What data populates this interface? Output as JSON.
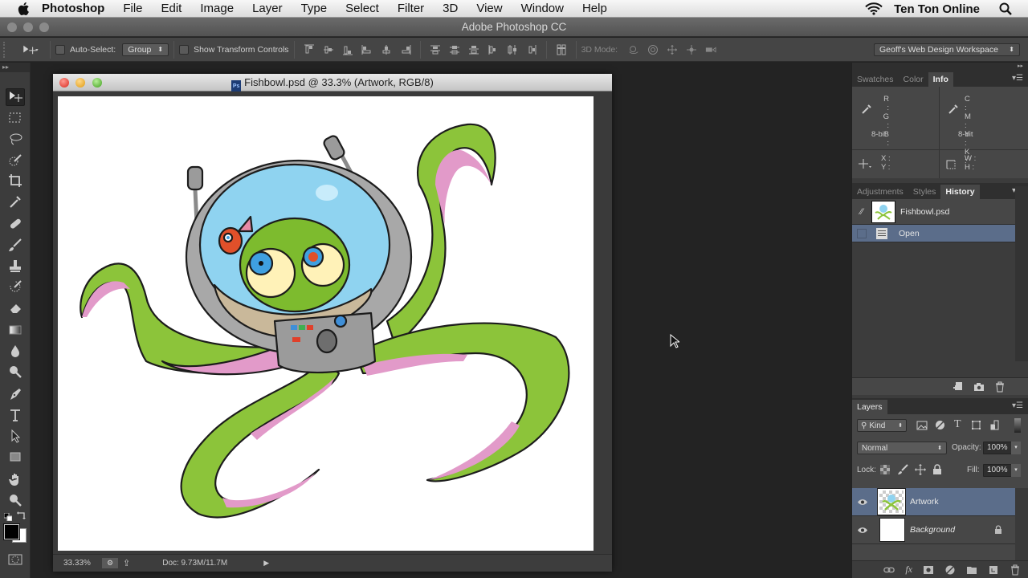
{
  "menubar": {
    "app_name": "Photoshop",
    "items": [
      "File",
      "Edit",
      "Image",
      "Layer",
      "Type",
      "Select",
      "Filter",
      "3D",
      "View",
      "Window",
      "Help"
    ],
    "user": "Ten Ton Online"
  },
  "titlebar": {
    "title": "Adobe Photoshop CC"
  },
  "options": {
    "auto_select_label": "Auto-Select:",
    "auto_select_checked": false,
    "auto_select_target": "Group",
    "show_transform_label": "Show Transform Controls",
    "show_transform_checked": false,
    "mode_3d_label": "3D Mode:",
    "workspace": "Geoff's Web Design Workspace"
  },
  "tools": [
    {
      "name": "move",
      "icon": "move-tool-icon"
    },
    {
      "name": "rectangular-marquee",
      "icon": "marquee-tool-icon"
    },
    {
      "name": "lasso",
      "icon": "lasso-tool-icon"
    },
    {
      "name": "quick-selection",
      "icon": "quick-selection-tool-icon"
    },
    {
      "name": "crop",
      "icon": "crop-tool-icon"
    },
    {
      "name": "eyedropper",
      "icon": "eyedropper-tool-icon"
    },
    {
      "name": "spot-healing",
      "icon": "healing-brush-tool-icon"
    },
    {
      "name": "brush",
      "icon": "brush-tool-icon"
    },
    {
      "name": "clone-stamp",
      "icon": "clone-stamp-tool-icon"
    },
    {
      "name": "history-brush",
      "icon": "history-brush-tool-icon"
    },
    {
      "name": "eraser",
      "icon": "eraser-tool-icon"
    },
    {
      "name": "gradient",
      "icon": "gradient-tool-icon"
    },
    {
      "name": "blur",
      "icon": "blur-tool-icon"
    },
    {
      "name": "dodge",
      "icon": "dodge-tool-icon"
    },
    {
      "name": "pen",
      "icon": "pen-tool-icon"
    },
    {
      "name": "type",
      "icon": "type-tool-icon"
    },
    {
      "name": "path-selection",
      "icon": "path-selection-tool-icon"
    },
    {
      "name": "rectangle",
      "icon": "rectangle-tool-icon"
    },
    {
      "name": "hand",
      "icon": "hand-tool-icon"
    },
    {
      "name": "zoom",
      "icon": "zoom-tool-icon"
    }
  ],
  "colors": {
    "foreground": "#000000",
    "background": "#ffffff",
    "selection": "#5b6d8a",
    "accent_panel": "#474747"
  },
  "document": {
    "title": "Fishbowl.psd @ 33.3% (Artwork, RGB/8)",
    "zoom": "33.33%",
    "doc_size": "Doc: 9.73M/11.7M"
  },
  "info_panel": {
    "tabs": [
      "Swatches",
      "Color",
      "Info"
    ],
    "active_tab": "Info",
    "rgb_labels": [
      "R :",
      "G :",
      "B :"
    ],
    "cmyk_labels": [
      "C :",
      "M :",
      "Y :",
      "K :"
    ],
    "bit_depth_left": "8-bit",
    "bit_depth_right": "8-bit",
    "xy_labels": [
      "X :",
      "Y :"
    ],
    "wh_labels": [
      "W :",
      "H :"
    ]
  },
  "history_panel": {
    "tabs": [
      "Adjustments",
      "Styles",
      "History"
    ],
    "active_tab": "History",
    "snapshot": "Fishbowl.psd",
    "states": [
      "Open"
    ]
  },
  "layers_panel": {
    "title": "Layers",
    "filter_kind": "Kind",
    "blend_mode": "Normal",
    "opacity_label": "Opacity:",
    "opacity": "100%",
    "lock_label": "Lock:",
    "fill_label": "Fill:",
    "fill": "100%",
    "layers": [
      {
        "name": "Artwork",
        "visible": true,
        "selected": true,
        "locked": false
      },
      {
        "name": "Background",
        "visible": true,
        "selected": false,
        "locked": true
      }
    ]
  }
}
